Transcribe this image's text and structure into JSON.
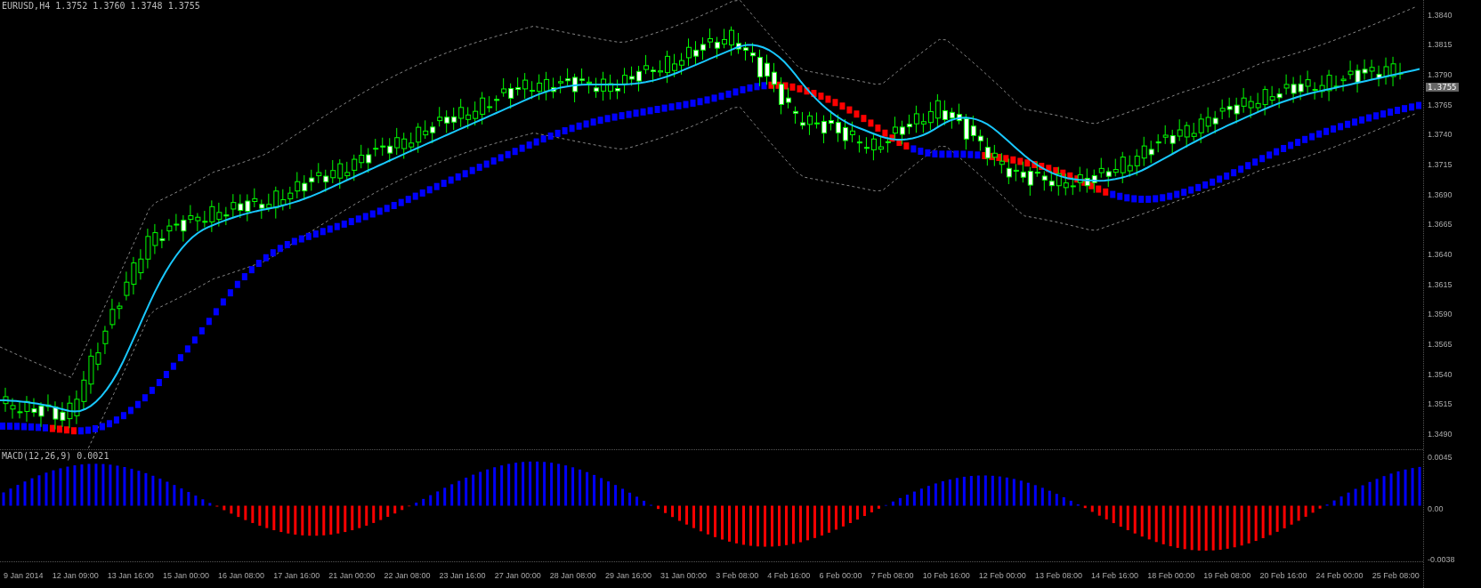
{
  "chart_title": "EURUSD,H4  1.3752 1.3760 1.3748 1.3755",
  "price_axis": [
    "1.3840",
    "1.3815",
    "1.3790",
    "1.3765",
    "1.3740",
    "1.3715",
    "1.3690",
    "1.3665",
    "1.3640",
    "1.3615",
    "1.3590",
    "1.3565",
    "1.3540",
    "1.3515",
    "1.3490"
  ],
  "current_price": "1.3755",
  "indicator": {
    "label": "MACD(12,26,9) 0.0021",
    "axis": [
      "0.0045",
      "0.00",
      "-0.0038"
    ]
  },
  "time_axis": [
    "9 Jan 2014",
    "12 Jan 09:00",
    "13 Jan 16:00",
    "15 Jan 00:00",
    "16 Jan 08:00",
    "17 Jan 16:00",
    "21 Jan 00:00",
    "22 Jan 08:00",
    "23 Jan 16:00",
    "27 Jan 00:00",
    "28 Jan 08:00",
    "29 Jan 16:00",
    "31 Jan 00:00",
    "3 Feb 08:00",
    "4 Feb 16:00",
    "6 Feb 00:00",
    "7 Feb 08:00",
    "10 Feb 16:00",
    "12 Feb 00:00",
    "13 Feb 08:00",
    "14 Feb 16:00",
    "18 Feb 00:00",
    "19 Feb 08:00",
    "20 Feb 16:00",
    "24 Feb 00:00",
    "25 Feb 08:00"
  ]
}
